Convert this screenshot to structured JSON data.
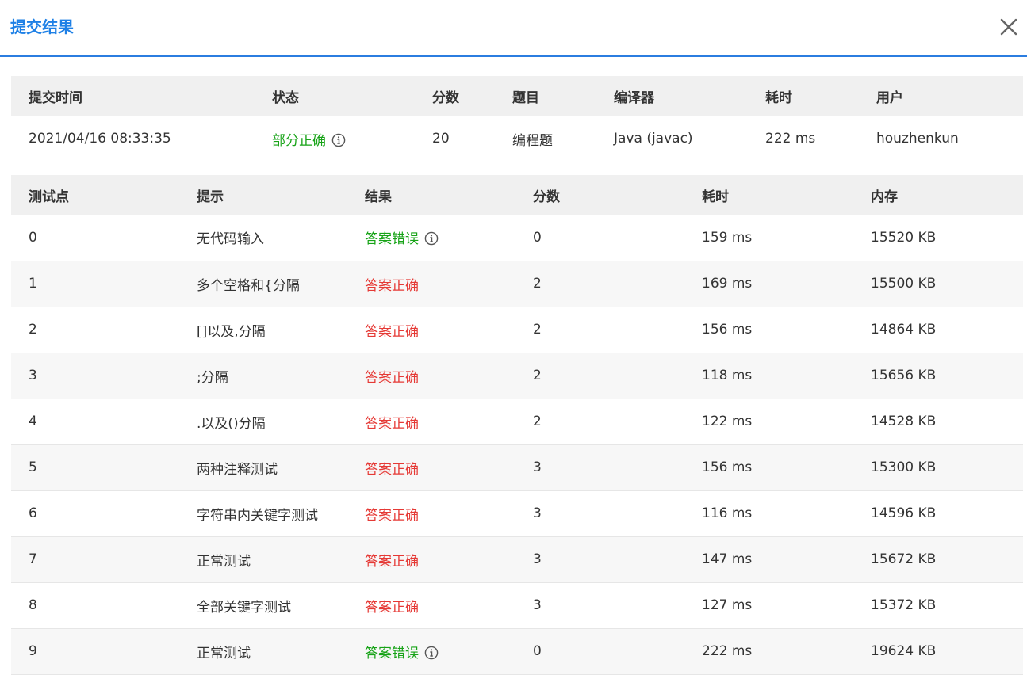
{
  "dialog": {
    "title": "提交结果"
  },
  "summary": {
    "headers": [
      "提交时间",
      "状态",
      "分数",
      "题目",
      "编译器",
      "耗时",
      "用户"
    ],
    "row": {
      "time": "2021/04/16 08:33:35",
      "status": "部分正确",
      "score": "20",
      "problem": "编程题",
      "compiler": "Java (javac)",
      "duration": "222 ms",
      "user": "houzhenkun"
    }
  },
  "cases": {
    "headers": [
      "测试点",
      "提示",
      "结果",
      "分数",
      "耗时",
      "内存"
    ],
    "rows": [
      {
        "id": "0",
        "hint": "无代码输入",
        "result": "答案错误",
        "score": "0",
        "time": "159 ms",
        "memory": "15520 KB"
      },
      {
        "id": "1",
        "hint": "多个空格和{分隔",
        "result": "答案正确",
        "score": "2",
        "time": "169 ms",
        "memory": "15500 KB"
      },
      {
        "id": "2",
        "hint": "[]以及,分隔",
        "result": "答案正确",
        "score": "2",
        "time": "156 ms",
        "memory": "14864 KB"
      },
      {
        "id": "3",
        "hint": ";分隔",
        "result": "答案正确",
        "score": "2",
        "time": "118 ms",
        "memory": "15656 KB"
      },
      {
        "id": "4",
        "hint": ".以及()分隔",
        "result": "答案正确",
        "score": "2",
        "time": "122 ms",
        "memory": "14528 KB"
      },
      {
        "id": "5",
        "hint": "两种注释测试",
        "result": "答案正确",
        "score": "3",
        "time": "156 ms",
        "memory": "15300 KB"
      },
      {
        "id": "6",
        "hint": "字符串内关键字测试",
        "result": "答案正确",
        "score": "3",
        "time": "116 ms",
        "memory": "14596 KB"
      },
      {
        "id": "7",
        "hint": "正常测试",
        "result": "答案正确",
        "score": "3",
        "time": "147 ms",
        "memory": "15672 KB"
      },
      {
        "id": "8",
        "hint": "全部关键字测试",
        "result": "答案正确",
        "score": "3",
        "time": "127 ms",
        "memory": "15372 KB"
      },
      {
        "id": "9",
        "hint": "正常测试",
        "result": "答案错误",
        "score": "0",
        "time": "222 ms",
        "memory": "19624 KB"
      }
    ]
  },
  "colors": {
    "accent": "#1e80e6",
    "correct_text": "#e53935",
    "wrong_text": "#17a317",
    "partial_text": "#17a317"
  },
  "icons": {
    "close": "close-icon",
    "info": "info-icon"
  }
}
